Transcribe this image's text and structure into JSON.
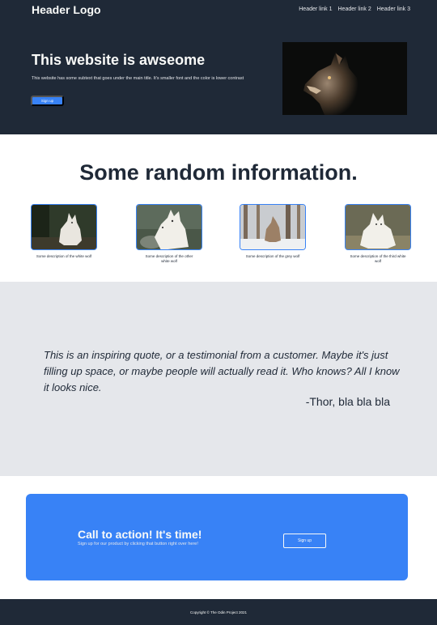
{
  "header": {
    "logo": "Header Logo",
    "links": [
      "Header link 1",
      "Header link 2",
      "Header link 3"
    ]
  },
  "hero": {
    "title": "This website is awseome",
    "subtitle": "This website has some subtext that goes under the main title. It's smaller font and the color is lower contrast",
    "signup_label": "Sign up"
  },
  "info": {
    "title": "Some random information.",
    "cards": [
      {
        "text": "Some description of the white wolf"
      },
      {
        "text": "Some description of the other white wolf"
      },
      {
        "text": "Some description of the grey wolf"
      },
      {
        "text": "Some description of the third white wolf"
      }
    ]
  },
  "quote": {
    "text": "This is an inspiring quote, or a testimonial from a customer. Maybe it's just filling up space, or maybe people will actually read it. Who knows? All I know it looks nice.",
    "author": "-Thor, bla bla bla"
  },
  "cta": {
    "title": "Call to action! It's time!",
    "subtitle": "Sign up for our product by clicking that button right over here!",
    "signup_label": "Sign up"
  },
  "footer": {
    "text": "Copyright © The Odin Project 2021"
  },
  "colors": {
    "dark": "#1f2937",
    "accent": "#3882f6",
    "light_grey": "#e5e7eb",
    "off_white": "#f9faf8"
  }
}
